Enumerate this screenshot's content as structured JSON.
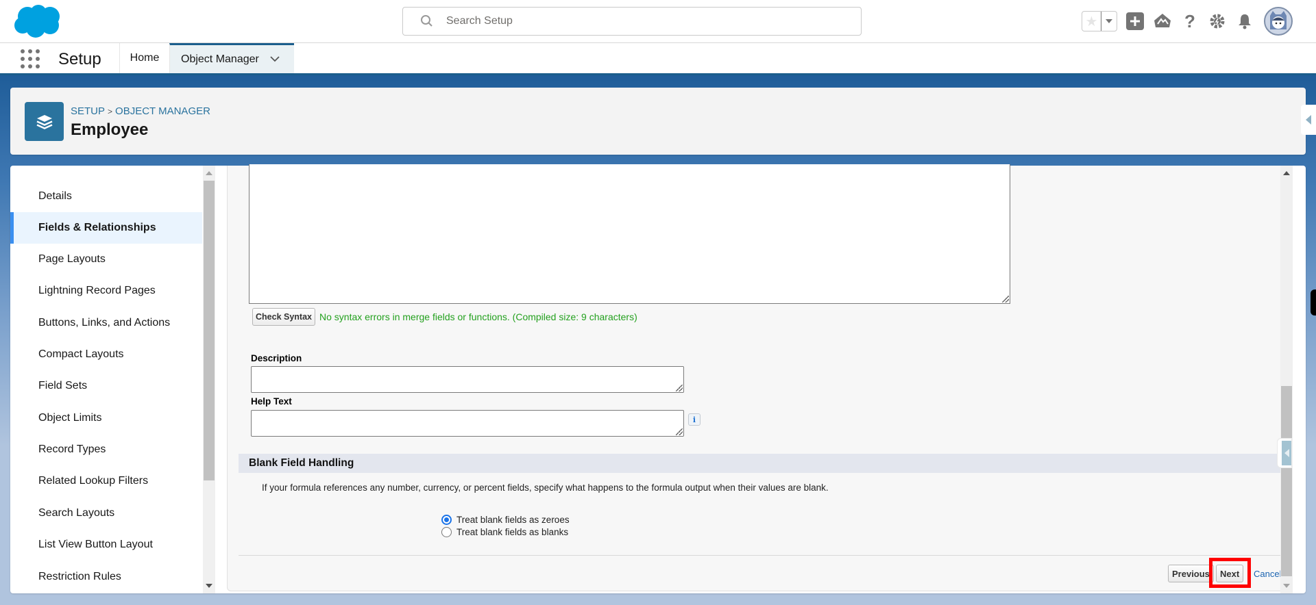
{
  "header": {
    "search": {
      "placeholder": "Search Setup",
      "value": ""
    },
    "icons": [
      "favorites-star-icon",
      "favorites-dropdown-icon",
      "global-actions-plus-icon",
      "trailhead-icon",
      "help-icon",
      "setup-gear-icon",
      "notifications-bell-icon",
      "user-avatar"
    ]
  },
  "nav": {
    "app_name": "Setup",
    "tabs": [
      {
        "label": "Home",
        "active": false
      },
      {
        "label": "Object Manager",
        "active": true
      }
    ]
  },
  "page_header": {
    "breadcrumb": [
      "SETUP",
      "OBJECT MANAGER"
    ],
    "breadcrumb_separator": ">",
    "title": "Employee",
    "icon": "layers-icon"
  },
  "sidebar": {
    "items": [
      {
        "label": "Details",
        "active": false
      },
      {
        "label": "Fields & Relationships",
        "active": true
      },
      {
        "label": "Page Layouts",
        "active": false
      },
      {
        "label": "Lightning Record Pages",
        "active": false
      },
      {
        "label": "Buttons, Links, and Actions",
        "active": false
      },
      {
        "label": "Compact Layouts",
        "active": false
      },
      {
        "label": "Field Sets",
        "active": false
      },
      {
        "label": "Object Limits",
        "active": false
      },
      {
        "label": "Record Types",
        "active": false
      },
      {
        "label": "Related Lookup Filters",
        "active": false
      },
      {
        "label": "Search Layouts",
        "active": false
      },
      {
        "label": "List View Button Layout",
        "active": false
      },
      {
        "label": "Restriction Rules",
        "active": false
      }
    ]
  },
  "form": {
    "formula_value": "",
    "check_syntax_label": "Check Syntax",
    "syntax_message": "No syntax errors in merge fields or functions. (Compiled size: 9 characters)",
    "description": {
      "label": "Description",
      "value": ""
    },
    "help_text": {
      "label": "Help Text",
      "value": "",
      "info_icon": "i"
    },
    "blank_field_handling": {
      "title": "Blank Field Handling",
      "description": "If your formula references any number, currency, or percent fields, specify what happens to the formula output when their values are blank.",
      "options": [
        {
          "label": "Treat blank fields as zeroes",
          "checked": true
        },
        {
          "label": "Treat blank fields as blanks",
          "checked": false
        }
      ]
    },
    "buttons": {
      "previous": "Previous",
      "next": "Next",
      "cancel": "Cancel"
    }
  },
  "colors": {
    "brand_blue": "#00a1e0",
    "object_icon_bg": "#2a739e",
    "active_nav_accent": "#3b8ff0",
    "success_text": "#23a01e",
    "highlight_border": "#ff0000",
    "link": "#1a63b0"
  }
}
